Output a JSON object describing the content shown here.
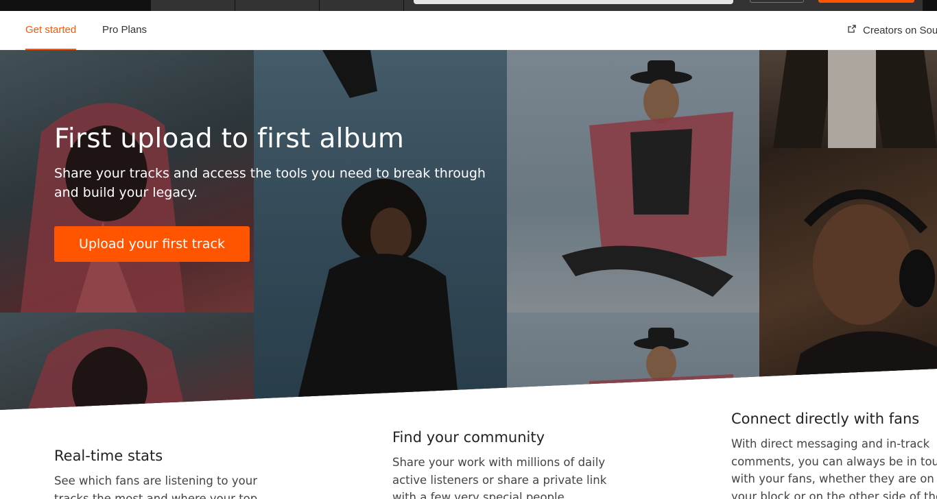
{
  "subnav": {
    "tabs": [
      {
        "label": "Get started",
        "active": true
      },
      {
        "label": "Pro Plans",
        "active": false
      }
    ],
    "creators_link": "Creators on SoundCloud",
    "external_icon": "external-link-icon"
  },
  "hero": {
    "title": "First upload to first album",
    "subtitle": "Share your tracks and access the tools you need to break through and build your legacy.",
    "cta_label": "Upload your first track"
  },
  "features": [
    {
      "title": "Real-time stats",
      "text": "See which fans are listening to your tracks the most and where your top"
    },
    {
      "title": "Find your community",
      "text": "Share your work with millions of daily active listeners or share a private link with a few very special people."
    },
    {
      "title": "Connect directly with fans",
      "text": "With direct messaging and in-track comments, you can always be in touch with your fans, whether they are on your block or on the other side of the"
    }
  ],
  "colors": {
    "accent": "#ff5500",
    "header_bg": "#333333"
  }
}
